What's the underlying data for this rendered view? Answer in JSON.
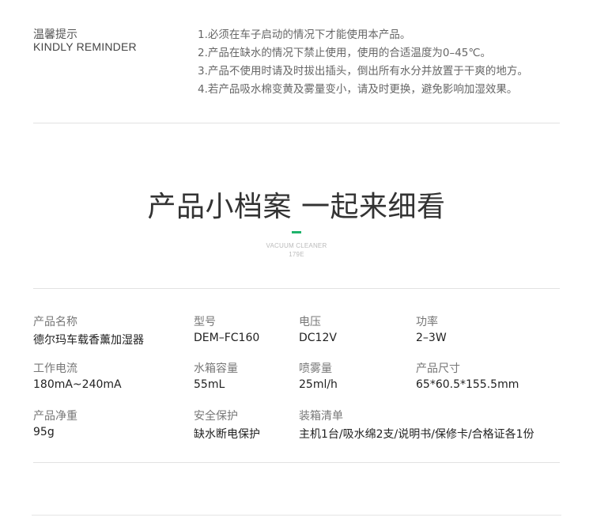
{
  "reminder": {
    "title_cn": "温馨提示",
    "title_en": "KINDLY REMINDER",
    "items": [
      "1.必须在车子启动的情况下才能使用本产品。",
      "2.产品在缺水的情况下禁止使用，使用的合适温度为0–45℃。",
      "3.产品不使用时请及时拔出插头，倒出所有水分并放置于干爽的地方。",
      "4.若产品吸水棉变黄及雾量变小，请及时更换，避免影响加湿效果。"
    ]
  },
  "section": {
    "headline": "产品小档案 一起来细看",
    "sub_line1": "VACUUM CLEANER",
    "sub_line2": "179E",
    "accent_color": "#1fb36b"
  },
  "specs": [
    {
      "label": "产品名称",
      "value": "德尔玛车载香薰加湿器"
    },
    {
      "label": "型号",
      "value": "DEM–FC160"
    },
    {
      "label": "电压",
      "value": "DC12V"
    },
    {
      "label": "功率",
      "value": "2–3W"
    },
    {
      "label": "工作电流",
      "value": "180mA~240mA"
    },
    {
      "label": "水箱容量",
      "value": "55mL"
    },
    {
      "label": "喷雾量",
      "value": "25ml/h"
    },
    {
      "label": "产品尺寸",
      "value": "65*60.5*155.5mm"
    },
    {
      "label": "产品净重",
      "value": "95g"
    },
    {
      "label": "安全保护",
      "value": "缺水断电保护"
    },
    {
      "label": "装箱清单",
      "value": "主机1台/吸水绵2支/说明书/保修卡/合格证各1份"
    }
  ]
}
